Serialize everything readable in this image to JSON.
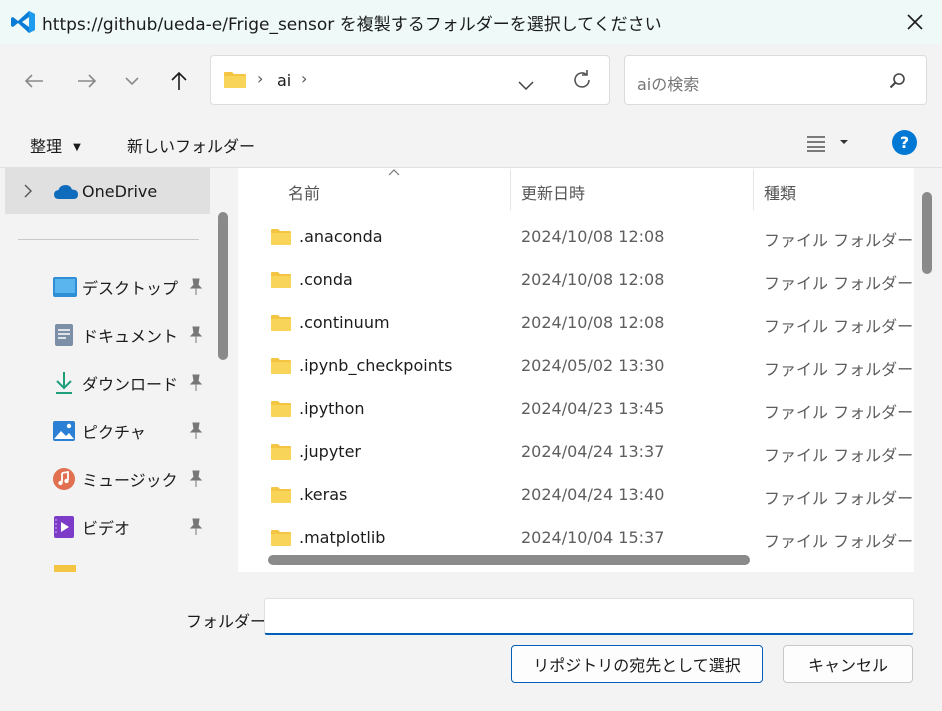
{
  "dialog": {
    "title": "https://github/ueda-e/Frige_sensor を複製するフォルダーを選択してください"
  },
  "nav": {
    "path": [
      "ai"
    ],
    "search_placeholder": "aiの検索"
  },
  "commands": {
    "organize": "整理",
    "new_folder": "新しいフォルダー"
  },
  "sidebar": {
    "top_item": "OneDrive",
    "items": [
      {
        "label": "デスクトップ",
        "icon": "desktop-icon"
      },
      {
        "label": "ドキュメント",
        "icon": "documents-icon"
      },
      {
        "label": "ダウンロード",
        "icon": "download-icon"
      },
      {
        "label": "ピクチャ",
        "icon": "pictures-icon"
      },
      {
        "label": "ミュージック",
        "icon": "music-icon"
      },
      {
        "label": "ビデオ",
        "icon": "videos-icon"
      }
    ]
  },
  "columns": {
    "name": "名前",
    "modified": "更新日時",
    "type": "種類"
  },
  "files": [
    {
      "name": ".anaconda",
      "modified": "2024/10/08 12:08",
      "type": "ファイル フォルダー"
    },
    {
      "name": ".conda",
      "modified": "2024/10/08 12:08",
      "type": "ファイル フォルダー"
    },
    {
      "name": ".continuum",
      "modified": "2024/10/08 12:08",
      "type": "ファイル フォルダー"
    },
    {
      "name": ".ipynb_checkpoints",
      "modified": "2024/05/02 13:30",
      "type": "ファイル フォルダー"
    },
    {
      "name": ".ipython",
      "modified": "2024/04/23 13:45",
      "type": "ファイル フォルダー"
    },
    {
      "name": ".jupyter",
      "modified": "2024/04/24 13:37",
      "type": "ファイル フォルダー"
    },
    {
      "name": ".keras",
      "modified": "2024/04/24 13:40",
      "type": "ファイル フォルダー"
    },
    {
      "name": ".matplotlib",
      "modified": "2024/10/04 15:37",
      "type": "ファイル フォルダー"
    }
  ],
  "footer": {
    "folder_label": "フォルダー:",
    "folder_value": "",
    "select_button": "リポジトリの宛先として選択",
    "cancel_button": "キャンセル"
  },
  "colors": {
    "accent": "#005fb8",
    "folder": "#f4c542",
    "onedrive": "#0f6cbd",
    "help": "#0078d4"
  }
}
